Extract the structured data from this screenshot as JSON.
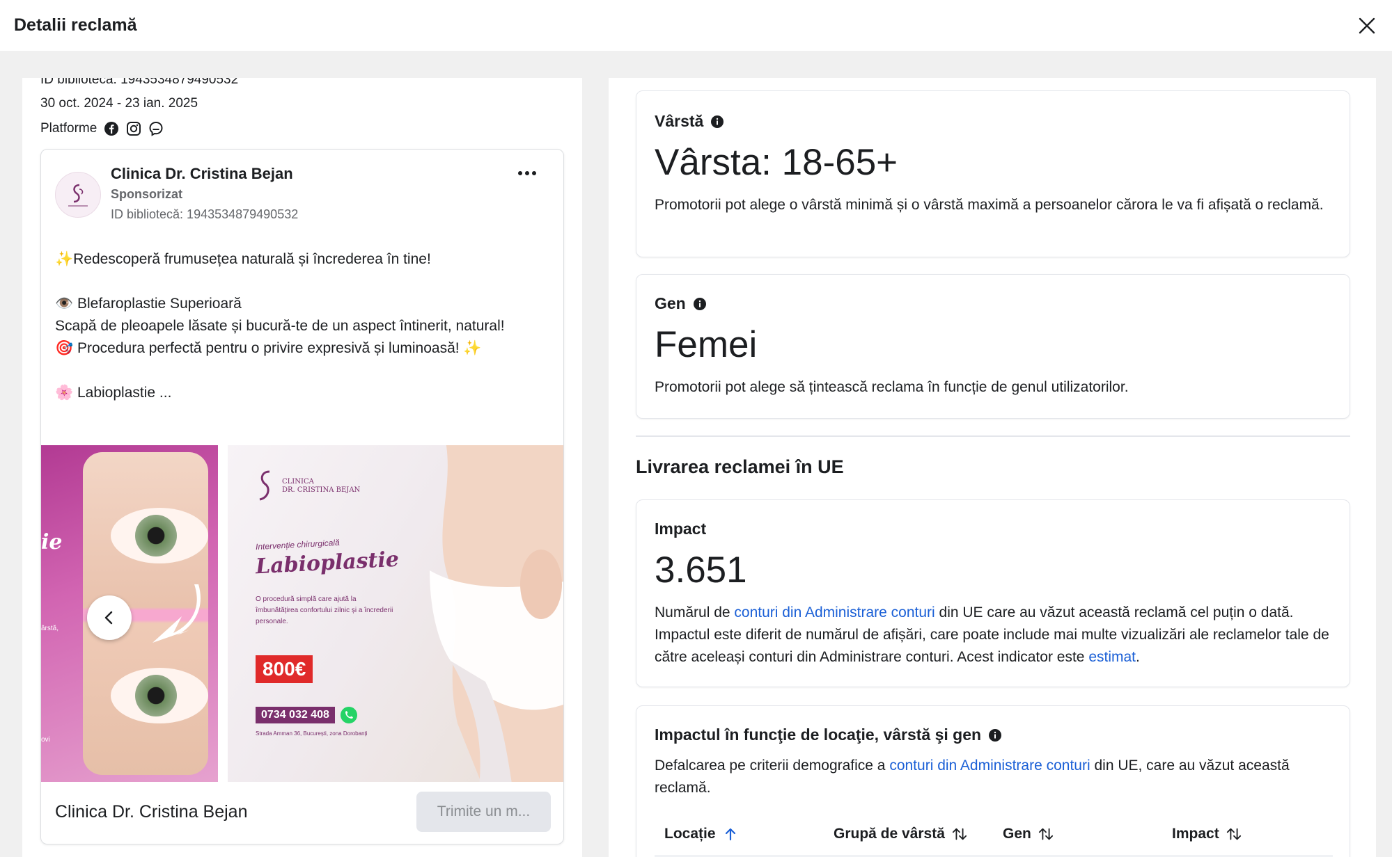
{
  "header": {
    "title": "Detalii reclamă"
  },
  "left": {
    "cut_line": "ID bibliotecă: 1943534879490532",
    "date_range": "30 oct. 2024 - 23 ian. 2025",
    "platforms_label": "Platforme",
    "platform_icons": [
      "facebook-icon",
      "instagram-icon",
      "messenger-icon"
    ],
    "ad": {
      "advertiser": "Clinica Dr. Cristina Bejan",
      "sponsored": "Sponsorizat",
      "library_id": "ID bibliotecă: 1943534879490532",
      "lines": [
        "✨Redescoperă frumusețea naturală și încrederea în tine!",
        "👁️ Blefaroplastie Superioară",
        "Scapă de pleoapele lăsate și bucură-te de un aspect întinerit, natural!",
        "🎯 Procedura perfectă pentru o privire expresivă și luminoasă! ✨",
        "🌸 Labioplastie ..."
      ],
      "slide1": {
        "word": "ie",
        "small": "ârstă,",
        "small2": "ovi"
      },
      "slide2": {
        "logo_line1": "CLINICA",
        "logo_line2": "DR. CRISTINA BEJAN",
        "subtitle": "Intervenție chirurgicală",
        "title": "Labioplastie",
        "description": "O procedură simplă care ajută la îmbunătățirea confortului zilnic și a încrederii personale.",
        "price": "800€",
        "phone": "0734 032 408",
        "address": "Strada Amman 36, București, zona Dorobanți"
      },
      "footer_name": "Clinica Dr. Cristina Bejan",
      "cta": "Trimite un m..."
    }
  },
  "right": {
    "age": {
      "title": "Vârstă",
      "value": "Vârsta: 18-65+",
      "description": "Promotorii pot alege o vârstă minimă și o vârstă maximă a persoanelor cărora le va fi afișată o reclamă."
    },
    "gender": {
      "title": "Gen",
      "value": "Femei",
      "description": "Promotorii pot alege să țintească reclama în funcție de genul utilizatorilor."
    },
    "section_title": "Livrarea reclamei în UE",
    "impact": {
      "title": "Impact",
      "value": "3.651",
      "desc_pre": "Numărul de ",
      "desc_link1": "conturi din Administrare conturi",
      "desc_mid": " din UE care au văzut această reclamă cel puțin o dată. Impactul este diferit de numărul de afișări, care poate include mai multe vizualizări ale reclamelor tale de către aceleași conturi din Administrare conturi. Acest indicator este ",
      "desc_link2": "estimat",
      "desc_post": "."
    },
    "breakdown": {
      "title": "Impactul în funcţie de locaţie, vârstă şi gen",
      "desc_pre": "Defalcarea pe criterii demografice a ",
      "desc_link": "conturi din Administrare conturi",
      "desc_post": " din UE, care au văzut această reclamă.",
      "columns": [
        "Locație",
        "Grupă de vârstă",
        "Gen",
        "Impact"
      ]
    }
  },
  "colors": {
    "link": "#1a5fd6",
    "brand": "#7a2f6c",
    "price": "#e02a2a"
  }
}
